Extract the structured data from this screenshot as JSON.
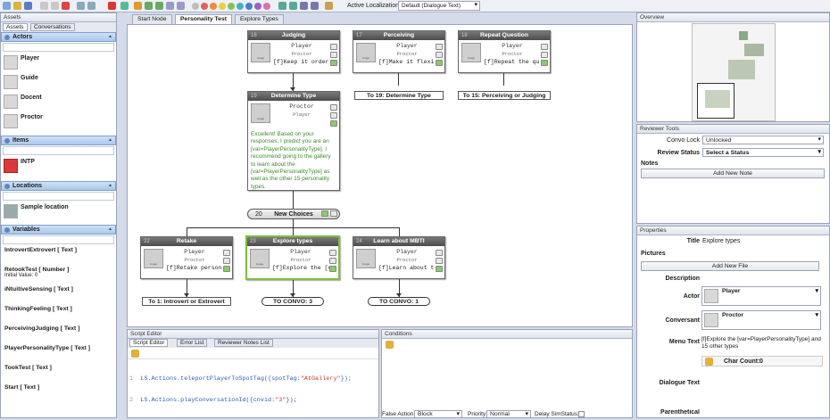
{
  "toolbar": {
    "localization_label": "Active Localization:",
    "localization_value": "Default (Dialogue Text)"
  },
  "assets": {
    "title": "Assets",
    "tabs": [
      "Assets",
      "Conversations"
    ],
    "actors_header": "Actors",
    "actors": [
      "Player",
      "Guide",
      "Docent",
      "Proctor"
    ],
    "items_header": "Items",
    "items": [
      "INTP"
    ],
    "locations_header": "Locations",
    "locations": [
      "Sample location"
    ],
    "variables_header": "Variables",
    "variables": [
      {
        "name": "IntrovertExtrovert [ Text ]",
        "sub": ""
      },
      {
        "name": "RetookTest [ Number ]",
        "sub": "Initial Value: 0"
      },
      {
        "name": "iNtuitiveSensing [ Text ]",
        "sub": ""
      },
      {
        "name": "ThinkingFeeling [ Text ]",
        "sub": ""
      },
      {
        "name": "PerceivingJudging [ Text ]",
        "sub": ""
      },
      {
        "name": "PlayerPersonalityType [ Text ]",
        "sub": ""
      },
      {
        "name": "TookTest [ Text ]",
        "sub": ""
      },
      {
        "name": "Start [ Text ]",
        "sub": ""
      }
    ]
  },
  "doc_tabs": [
    "Start Node",
    "Personality Test",
    "Explore Types"
  ],
  "graph": {
    "nodes": {
      "judging": {
        "num": "16",
        "title": "Judging",
        "actor": "Player",
        "conversant": "Proctor",
        "text": "[f]Keep it order"
      },
      "perceiving": {
        "num": "17",
        "title": "Perceiving",
        "actor": "Player",
        "conversant": "Proctor",
        "text": "[f]Make it flexi"
      },
      "repeat": {
        "num": "18",
        "title": "Repeat Question",
        "actor": "Player",
        "conversant": "Proctor",
        "text": "[f]Repeat the qu"
      },
      "determine": {
        "num": "19",
        "title": "Determine Type",
        "actor": "Proctor",
        "conversant": "Player",
        "body": "Excellent! Based on your responses, I predict you are an [var=PlayerPersonalityType]. I recommend going to the gallery to learn about the [var=PlayerPersonalityType] as well as the other 15 personality types."
      },
      "retake": {
        "num": "22",
        "title": "Retake",
        "actor": "Player",
        "conversant": "Proctor",
        "text": "[f]Retake person"
      },
      "explore": {
        "num": "23",
        "title": "Explore types",
        "actor": "Player",
        "conversant": "Proctor",
        "text": "[f]Explore the [v"
      },
      "learn": {
        "num": "24",
        "title": "Learn about MBTI",
        "actor": "Player",
        "conversant": "Proctor",
        "text": "[f]Learn about t"
      }
    },
    "hub": {
      "num": "20",
      "title": "New Choices"
    },
    "links": {
      "to19": "To 19: Determine Type",
      "to15": "To 15: Perceiving or Judging",
      "to1": "To 1: Introvert or Extrovert",
      "convo3": "TO CONVO: 3",
      "convo1": "TO CONVO: 1"
    }
  },
  "script_editor": {
    "title": "Script Editor",
    "tabs": [
      "Script Editor",
      "Error List",
      "Reviewer Notes List"
    ],
    "lines": [
      {
        "n": "1",
        "pre": "LS.Actions.teleportPlayerToSpotTag({spotTag:",
        "str": "\"AtGallery\"",
        "post": "});"
      },
      {
        "n": "2",
        "pre": "LS.Actions.playConversationId({cnvid:",
        "str": "\"3\"",
        "post": "});"
      }
    ]
  },
  "conditions": {
    "title": "Conditions",
    "false_action_label": "False Action:",
    "false_action": "Block",
    "priority_label": "Priority:",
    "priority": "Normal",
    "delay_label": "Delay SimStatus:"
  },
  "overview": {
    "title": "Overview"
  },
  "reviewer": {
    "title": "Reviewer Tools",
    "convo_lock_label": "Convo Lock",
    "convo_lock": "Unlocked",
    "review_status_label": "Review Status",
    "review_status": "Select a Status",
    "notes_label": "Notes",
    "add_note": "Add New Note"
  },
  "properties": {
    "title": "Properties",
    "title_label": "Title",
    "title_value": "Explore types",
    "pictures_label": "Pictures",
    "add_file": "Add New File",
    "description_label": "Description",
    "actor_label": "Actor",
    "actor": "Player",
    "conversant_label": "Conversant",
    "conversant": "Proctor",
    "menu_text_label": "Menu Text",
    "menu_text": "[f]Explore the [var=PlayerPersonalityType] and 15 other types",
    "char_count_label": "Char Count:",
    "char_count": "0",
    "dialogue_text_label": "Dialogue Text",
    "parenthetical_label": "Parenthetical"
  }
}
